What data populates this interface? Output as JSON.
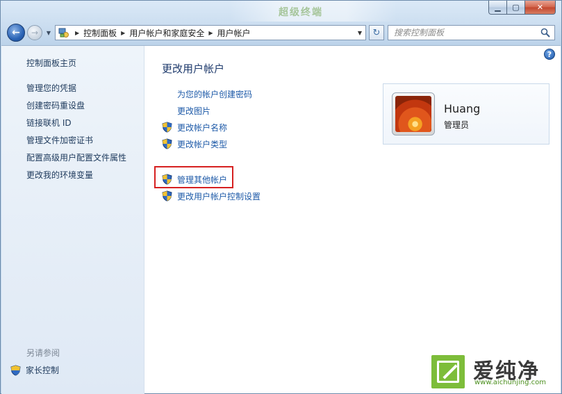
{
  "title_deco": "超级终端",
  "window_controls": {
    "minimize": "▁",
    "maximize": "▢",
    "close": "✕"
  },
  "nav": {
    "back": "←",
    "forward": "→",
    "recent": "▼",
    "breadcrumbs": [
      "控制面板",
      "用户帐户和家庭安全",
      "用户帐户"
    ],
    "dropdown": "▼",
    "refresh": "↻"
  },
  "search": {
    "placeholder": "搜索控制面板"
  },
  "sidebar": {
    "items": [
      {
        "label": "控制面板主页"
      },
      {
        "label": "管理您的凭据"
      },
      {
        "label": "创建密码重设盘"
      },
      {
        "label": "链接联机 ID"
      },
      {
        "label": "管理文件加密证书"
      },
      {
        "label": "配置高级用户配置文件属性"
      },
      {
        "label": "更改我的环境变量"
      }
    ],
    "see_also": "另请参阅",
    "parental_controls": "家长控制"
  },
  "main": {
    "help": "?",
    "title": "更改用户帐户",
    "tasks": [
      {
        "label": "为您的帐户创建密码",
        "shield": false
      },
      {
        "label": "更改图片",
        "shield": false
      },
      {
        "label": "更改帐户名称",
        "shield": true
      },
      {
        "label": "更改帐户类型",
        "shield": true
      }
    ],
    "other_tasks": [
      {
        "label": "管理其他帐户",
        "shield": true,
        "highlighted": true
      },
      {
        "label": "更改用户帐户控制设置",
        "shield": true
      }
    ]
  },
  "user": {
    "name": "Huang",
    "role": "管理员"
  },
  "watermark": {
    "brand": "爱纯净",
    "url": "www.aichunjing.com"
  },
  "colors": {
    "link": "#1e5aa8",
    "highlight_border": "#d62020",
    "accent": "#1e3a6c"
  }
}
